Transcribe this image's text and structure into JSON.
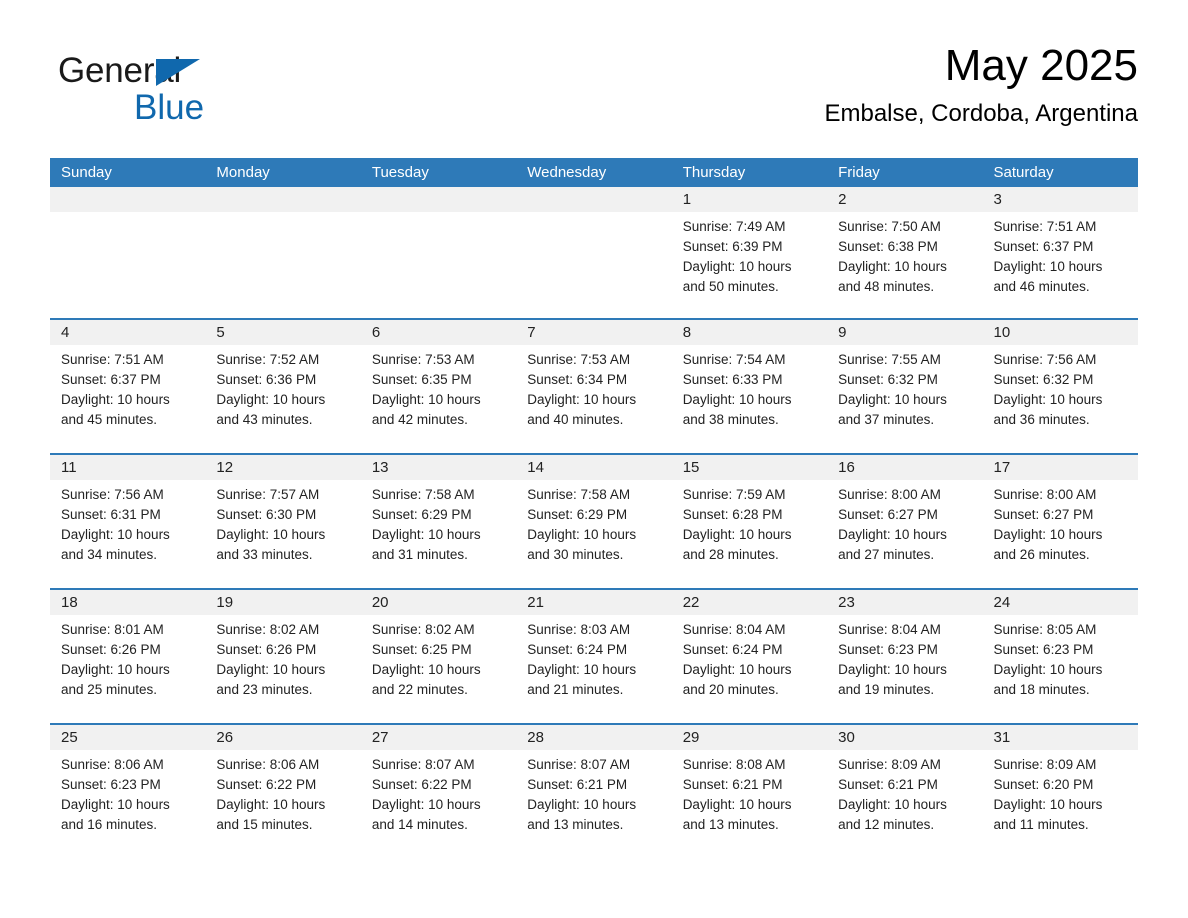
{
  "brand": {
    "word1": "General",
    "word2": "Blue",
    "triangle_color": "#1068ad",
    "text_color": "#1a1a1a"
  },
  "header": {
    "month_title": "May 2025",
    "location": "Embalse, Cordoba, Argentina"
  },
  "theme": {
    "header_bg": "#2e7ab8",
    "header_text": "#ffffff",
    "date_strip_bg": "#f1f1f1",
    "cell_bg": "#ffffff",
    "row_divider": "#2e7ab8",
    "body_text": "#222222"
  },
  "weekdays": [
    "Sunday",
    "Monday",
    "Tuesday",
    "Wednesday",
    "Thursday",
    "Friday",
    "Saturday"
  ],
  "labels": {
    "sunrise_prefix": "Sunrise:",
    "sunset_prefix": "Sunset:",
    "daylight_prefix": "Daylight:"
  },
  "weeks": [
    [
      {
        "day": "",
        "sunrise": "",
        "sunset": "",
        "daylight_line1": "",
        "daylight_line2": "",
        "empty": true
      },
      {
        "day": "",
        "sunrise": "",
        "sunset": "",
        "daylight_line1": "",
        "daylight_line2": "",
        "empty": true
      },
      {
        "day": "",
        "sunrise": "",
        "sunset": "",
        "daylight_line1": "",
        "daylight_line2": "",
        "empty": true
      },
      {
        "day": "",
        "sunrise": "",
        "sunset": "",
        "daylight_line1": "",
        "daylight_line2": "",
        "empty": true
      },
      {
        "day": "1",
        "sunrise": "Sunrise: 7:49 AM",
        "sunset": "Sunset: 6:39 PM",
        "daylight_line1": "Daylight: 10 hours",
        "daylight_line2": "and 50 minutes.",
        "empty": false
      },
      {
        "day": "2",
        "sunrise": "Sunrise: 7:50 AM",
        "sunset": "Sunset: 6:38 PM",
        "daylight_line1": "Daylight: 10 hours",
        "daylight_line2": "and 48 minutes.",
        "empty": false
      },
      {
        "day": "3",
        "sunrise": "Sunrise: 7:51 AM",
        "sunset": "Sunset: 6:37 PM",
        "daylight_line1": "Daylight: 10 hours",
        "daylight_line2": "and 46 minutes.",
        "empty": false
      }
    ],
    [
      {
        "day": "4",
        "sunrise": "Sunrise: 7:51 AM",
        "sunset": "Sunset: 6:37 PM",
        "daylight_line1": "Daylight: 10 hours",
        "daylight_line2": "and 45 minutes.",
        "empty": false
      },
      {
        "day": "5",
        "sunrise": "Sunrise: 7:52 AM",
        "sunset": "Sunset: 6:36 PM",
        "daylight_line1": "Daylight: 10 hours",
        "daylight_line2": "and 43 minutes.",
        "empty": false
      },
      {
        "day": "6",
        "sunrise": "Sunrise: 7:53 AM",
        "sunset": "Sunset: 6:35 PM",
        "daylight_line1": "Daylight: 10 hours",
        "daylight_line2": "and 42 minutes.",
        "empty": false
      },
      {
        "day": "7",
        "sunrise": "Sunrise: 7:53 AM",
        "sunset": "Sunset: 6:34 PM",
        "daylight_line1": "Daylight: 10 hours",
        "daylight_line2": "and 40 minutes.",
        "empty": false
      },
      {
        "day": "8",
        "sunrise": "Sunrise: 7:54 AM",
        "sunset": "Sunset: 6:33 PM",
        "daylight_line1": "Daylight: 10 hours",
        "daylight_line2": "and 38 minutes.",
        "empty": false
      },
      {
        "day": "9",
        "sunrise": "Sunrise: 7:55 AM",
        "sunset": "Sunset: 6:32 PM",
        "daylight_line1": "Daylight: 10 hours",
        "daylight_line2": "and 37 minutes.",
        "empty": false
      },
      {
        "day": "10",
        "sunrise": "Sunrise: 7:56 AM",
        "sunset": "Sunset: 6:32 PM",
        "daylight_line1": "Daylight: 10 hours",
        "daylight_line2": "and 36 minutes.",
        "empty": false
      }
    ],
    [
      {
        "day": "11",
        "sunrise": "Sunrise: 7:56 AM",
        "sunset": "Sunset: 6:31 PM",
        "daylight_line1": "Daylight: 10 hours",
        "daylight_line2": "and 34 minutes.",
        "empty": false
      },
      {
        "day": "12",
        "sunrise": "Sunrise: 7:57 AM",
        "sunset": "Sunset: 6:30 PM",
        "daylight_line1": "Daylight: 10 hours",
        "daylight_line2": "and 33 minutes.",
        "empty": false
      },
      {
        "day": "13",
        "sunrise": "Sunrise: 7:58 AM",
        "sunset": "Sunset: 6:29 PM",
        "daylight_line1": "Daylight: 10 hours",
        "daylight_line2": "and 31 minutes.",
        "empty": false
      },
      {
        "day": "14",
        "sunrise": "Sunrise: 7:58 AM",
        "sunset": "Sunset: 6:29 PM",
        "daylight_line1": "Daylight: 10 hours",
        "daylight_line2": "and 30 minutes.",
        "empty": false
      },
      {
        "day": "15",
        "sunrise": "Sunrise: 7:59 AM",
        "sunset": "Sunset: 6:28 PM",
        "daylight_line1": "Daylight: 10 hours",
        "daylight_line2": "and 28 minutes.",
        "empty": false
      },
      {
        "day": "16",
        "sunrise": "Sunrise: 8:00 AM",
        "sunset": "Sunset: 6:27 PM",
        "daylight_line1": "Daylight: 10 hours",
        "daylight_line2": "and 27 minutes.",
        "empty": false
      },
      {
        "day": "17",
        "sunrise": "Sunrise: 8:00 AM",
        "sunset": "Sunset: 6:27 PM",
        "daylight_line1": "Daylight: 10 hours",
        "daylight_line2": "and 26 minutes.",
        "empty": false
      }
    ],
    [
      {
        "day": "18",
        "sunrise": "Sunrise: 8:01 AM",
        "sunset": "Sunset: 6:26 PM",
        "daylight_line1": "Daylight: 10 hours",
        "daylight_line2": "and 25 minutes.",
        "empty": false
      },
      {
        "day": "19",
        "sunrise": "Sunrise: 8:02 AM",
        "sunset": "Sunset: 6:26 PM",
        "daylight_line1": "Daylight: 10 hours",
        "daylight_line2": "and 23 minutes.",
        "empty": false
      },
      {
        "day": "20",
        "sunrise": "Sunrise: 8:02 AM",
        "sunset": "Sunset: 6:25 PM",
        "daylight_line1": "Daylight: 10 hours",
        "daylight_line2": "and 22 minutes.",
        "empty": false
      },
      {
        "day": "21",
        "sunrise": "Sunrise: 8:03 AM",
        "sunset": "Sunset: 6:24 PM",
        "daylight_line1": "Daylight: 10 hours",
        "daylight_line2": "and 21 minutes.",
        "empty": false
      },
      {
        "day": "22",
        "sunrise": "Sunrise: 8:04 AM",
        "sunset": "Sunset: 6:24 PM",
        "daylight_line1": "Daylight: 10 hours",
        "daylight_line2": "and 20 minutes.",
        "empty": false
      },
      {
        "day": "23",
        "sunrise": "Sunrise: 8:04 AM",
        "sunset": "Sunset: 6:23 PM",
        "daylight_line1": "Daylight: 10 hours",
        "daylight_line2": "and 19 minutes.",
        "empty": false
      },
      {
        "day": "24",
        "sunrise": "Sunrise: 8:05 AM",
        "sunset": "Sunset: 6:23 PM",
        "daylight_line1": "Daylight: 10 hours",
        "daylight_line2": "and 18 minutes.",
        "empty": false
      }
    ],
    [
      {
        "day": "25",
        "sunrise": "Sunrise: 8:06 AM",
        "sunset": "Sunset: 6:23 PM",
        "daylight_line1": "Daylight: 10 hours",
        "daylight_line2": "and 16 minutes.",
        "empty": false
      },
      {
        "day": "26",
        "sunrise": "Sunrise: 8:06 AM",
        "sunset": "Sunset: 6:22 PM",
        "daylight_line1": "Daylight: 10 hours",
        "daylight_line2": "and 15 minutes.",
        "empty": false
      },
      {
        "day": "27",
        "sunrise": "Sunrise: 8:07 AM",
        "sunset": "Sunset: 6:22 PM",
        "daylight_line1": "Daylight: 10 hours",
        "daylight_line2": "and 14 minutes.",
        "empty": false
      },
      {
        "day": "28",
        "sunrise": "Sunrise: 8:07 AM",
        "sunset": "Sunset: 6:21 PM",
        "daylight_line1": "Daylight: 10 hours",
        "daylight_line2": "and 13 minutes.",
        "empty": false
      },
      {
        "day": "29",
        "sunrise": "Sunrise: 8:08 AM",
        "sunset": "Sunset: 6:21 PM",
        "daylight_line1": "Daylight: 10 hours",
        "daylight_line2": "and 13 minutes.",
        "empty": false
      },
      {
        "day": "30",
        "sunrise": "Sunrise: 8:09 AM",
        "sunset": "Sunset: 6:21 PM",
        "daylight_line1": "Daylight: 10 hours",
        "daylight_line2": "and 12 minutes.",
        "empty": false
      },
      {
        "day": "31",
        "sunrise": "Sunrise: 8:09 AM",
        "sunset": "Sunset: 6:20 PM",
        "daylight_line1": "Daylight: 10 hours",
        "daylight_line2": "and 11 minutes.",
        "empty": false
      }
    ]
  ]
}
